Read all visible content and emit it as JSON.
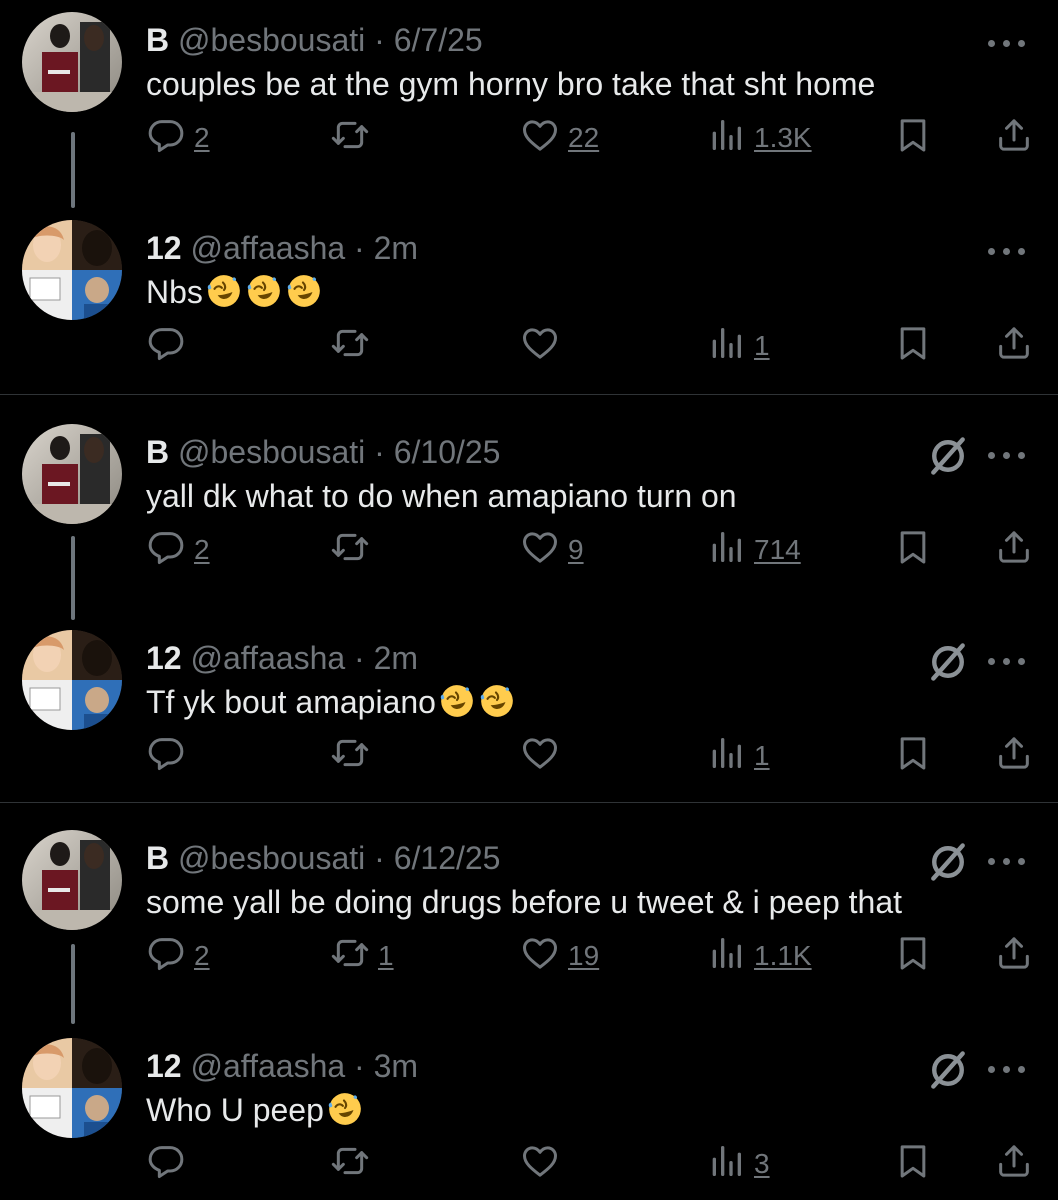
{
  "tweets": [
    {
      "name": "B",
      "handle": "@besbousati",
      "time": "6/7/25",
      "text": "couples be at the gym horny bro take that sht home",
      "emojis": [],
      "replies": "2",
      "retweets": "",
      "likes": "22",
      "views": "1.3K",
      "grok": false
    },
    {
      "name": "12",
      "handle": "@affaasha",
      "time": "2m",
      "text": "Nbs",
      "emojis": [
        "rofl",
        "rofl",
        "rofl"
      ],
      "replies": "",
      "retweets": "",
      "likes": "",
      "views": "1",
      "grok": false
    },
    {
      "name": "B",
      "handle": "@besbousati",
      "time": "6/10/25",
      "text": "yall dk what to do when amapiano turn on",
      "emojis": [],
      "replies": "2",
      "retweets": "",
      "likes": "9",
      "views": "714",
      "grok": true
    },
    {
      "name": "12",
      "handle": "@affaasha",
      "time": "2m",
      "text": "Tf yk bout amapiano",
      "emojis": [
        "rofl",
        "rofl"
      ],
      "replies": "",
      "retweets": "",
      "likes": "",
      "views": "1",
      "grok": true
    },
    {
      "name": "B",
      "handle": "@besbousati",
      "time": "6/12/25",
      "text": "some yall be doing drugs before u tweet & i peep that",
      "emojis": [],
      "replies": "2",
      "retweets": "1",
      "likes": "19",
      "views": "1.1K",
      "grok": true
    },
    {
      "name": "12",
      "handle": "@affaasha",
      "time": "3m",
      "text": "Who U peep",
      "emojis": [
        "rofl"
      ],
      "replies": "",
      "retweets": "",
      "likes": "",
      "views": "3",
      "grok": true
    }
  ],
  "separator": "·",
  "icons": {
    "reply": "reply-icon",
    "retweet": "retweet-icon",
    "like": "like-icon",
    "views": "views-icon",
    "bookmark": "bookmark-icon",
    "share": "share-icon",
    "more": "more-icon",
    "grok": "grok-icon",
    "emoji": "rolling-on-floor-laughing-emoji"
  },
  "colors": {
    "background": "#000000",
    "text": "#e7e9ea",
    "muted": "#71767b",
    "divider": "#2f3336",
    "thread_line": "#6e767d",
    "emoji": "#ffcc4d"
  }
}
